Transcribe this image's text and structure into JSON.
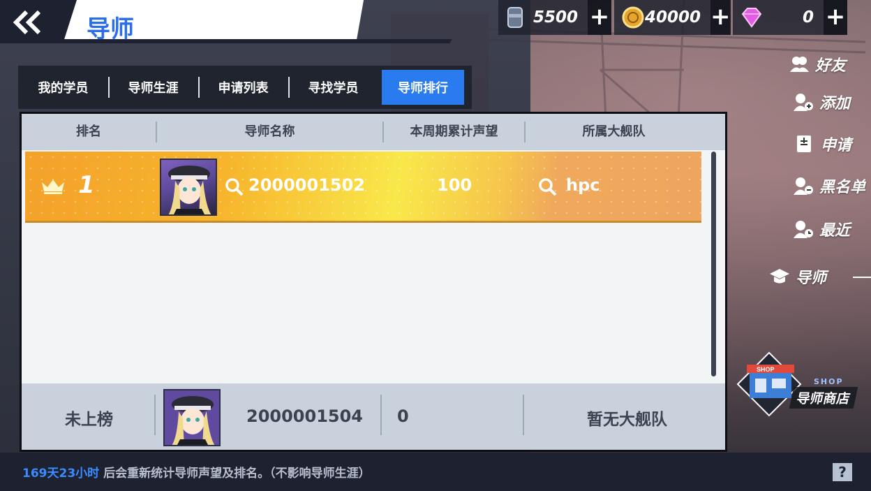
{
  "header": {
    "back_icon": "double-chevron-left-icon",
    "title": "导师"
  },
  "currencies": [
    {
      "icon": "oil-barrel-icon",
      "value": "5500",
      "plus": "+"
    },
    {
      "icon": "gold-coin-icon",
      "value": "40000",
      "plus": "+"
    },
    {
      "icon": "gem-icon",
      "value": "0",
      "plus": "+"
    }
  ],
  "tabs": [
    {
      "label": "我的学员",
      "active": false
    },
    {
      "label": "导师生涯",
      "active": false
    },
    {
      "label": "申请列表",
      "active": false
    },
    {
      "label": "寻找学员",
      "active": false
    },
    {
      "label": "导师排行",
      "active": true
    }
  ],
  "table": {
    "columns": [
      "排名",
      "导师名称",
      "本周期累计声望",
      "所属大舰队"
    ],
    "rows": [
      {
        "rank": "1",
        "name": "2000001502",
        "reputation": "100",
        "fleet": "hpc"
      }
    ],
    "mine": {
      "rank": "未上榜",
      "name": "2000001504",
      "reputation": "0",
      "fleet": "暂无大舰队"
    }
  },
  "side_menu": [
    {
      "icon": "friends-icon",
      "label": "好友"
    },
    {
      "icon": "add-user-icon",
      "label": "添加"
    },
    {
      "icon": "apply-icon",
      "label": "申请"
    },
    {
      "icon": "block-user-icon",
      "label": "黑名单"
    },
    {
      "icon": "recent-user-icon",
      "label": "最近"
    },
    {
      "icon": "graduation-cap-icon",
      "label": "导师"
    }
  ],
  "shop": {
    "tag": "SHOP",
    "label": "导师商店",
    "sign": "SHOP"
  },
  "footer": {
    "highlight": "169天23小时",
    "text": " 后会重新统计导师声望及排名。（不影响导师生涯）",
    "help": "?"
  },
  "colors": {
    "accent": "#2a7bf0",
    "title": "#2a6ee8",
    "gold_row": "#f7b52c"
  }
}
